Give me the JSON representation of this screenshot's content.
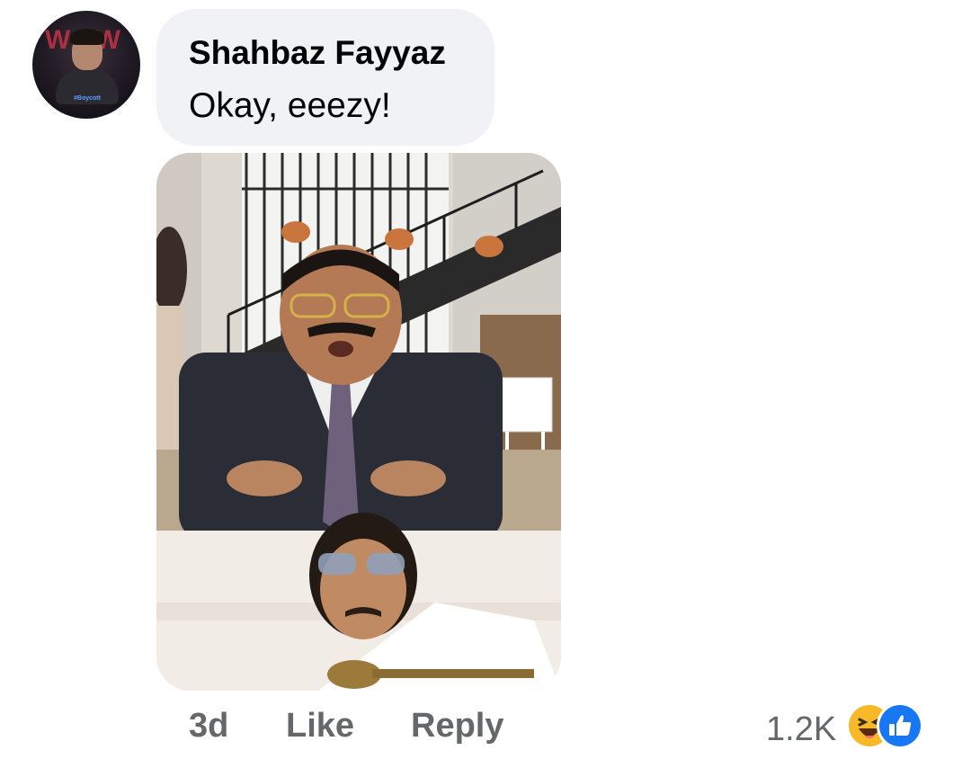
{
  "comment": {
    "author": "Shahbaz Fayyaz",
    "text": "Okay, eeezy!",
    "avatar_icon": "profile-avatar",
    "attachment": "meme-photo"
  },
  "actions": {
    "time": "3d",
    "like_label": "Like",
    "reply_label": "Reply"
  },
  "reactions": {
    "count": "1.2K",
    "icons": [
      "haha-reaction-icon",
      "like-reaction-icon"
    ],
    "colors": {
      "haha": "#f7b928",
      "like": "#1877f2"
    }
  },
  "colors": {
    "bubble": "#f0f2f5",
    "text": "#050505",
    "secondary_text": "#65676b"
  }
}
